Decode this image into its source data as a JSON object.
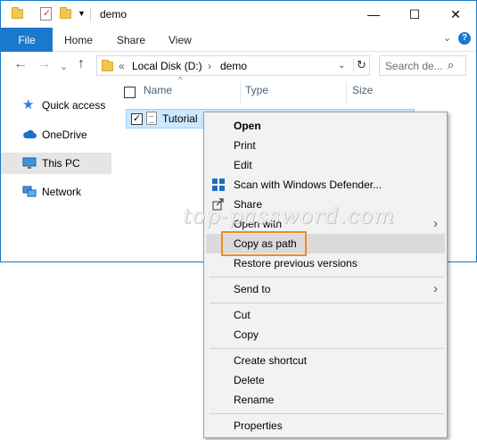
{
  "window": {
    "title": "demo",
    "controls": {
      "minimize": "—",
      "maximize": "☐",
      "close": "✕"
    }
  },
  "ribbon": {
    "tabs": [
      "File",
      "Home",
      "Share",
      "View"
    ],
    "collapse": "⌄",
    "help": "?"
  },
  "nav": {
    "back": "←",
    "forward": "→",
    "recent": "⌄",
    "up": "↑",
    "address": {
      "prefix": "«",
      "crumbs": [
        "Local Disk (D:)",
        "demo"
      ],
      "separator": "›"
    },
    "search_placeholder": "Search de..."
  },
  "sidebar": {
    "items": [
      {
        "label": "Quick access",
        "icon": "star-icon"
      },
      {
        "label": "OneDrive",
        "icon": "cloud-icon"
      },
      {
        "label": "This PC",
        "icon": "monitor-icon",
        "selected": true
      },
      {
        "label": "Network",
        "icon": "network-icon"
      }
    ]
  },
  "columns": [
    "Name",
    "Type",
    "Size"
  ],
  "files": [
    {
      "name": "Tutorial",
      "checked": true,
      "selected": true
    }
  ],
  "watermark": "top-password.com",
  "context_menu": {
    "items": [
      {
        "label": "Open",
        "bold": true
      },
      {
        "label": "Print"
      },
      {
        "label": "Edit"
      },
      {
        "label": "Scan with Windows Defender...",
        "icon": "defender-shield-icon"
      },
      {
        "label": "Share",
        "icon": "share-icon"
      },
      {
        "label": "Open with",
        "submenu": true
      },
      {
        "label": "Copy as path",
        "highlighted": true
      },
      {
        "label": "Restore previous versions"
      },
      {
        "label": "Send to",
        "submenu": true
      },
      {
        "label": "Cut"
      },
      {
        "label": "Copy"
      },
      {
        "label": "Create shortcut"
      },
      {
        "label": "Delete"
      },
      {
        "label": "Rename"
      },
      {
        "label": "Properties"
      }
    ],
    "submenu_arrow": "›"
  },
  "colors": {
    "accent": "#1979ca",
    "selection": "#cce8ff",
    "highlight_box": "#f08a24",
    "menu_bg": "#f2f2f2"
  }
}
